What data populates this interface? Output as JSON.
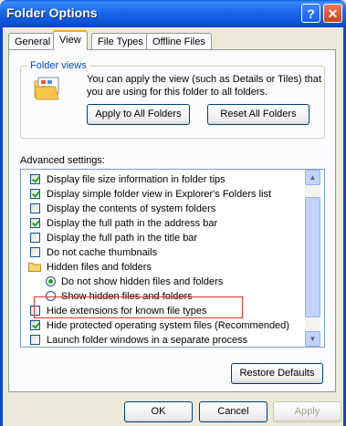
{
  "window": {
    "title": "Folder Options",
    "help_label": "?",
    "close_label": "✕"
  },
  "tabs": [
    {
      "label": "General"
    },
    {
      "label": "View"
    },
    {
      "label": "File Types"
    },
    {
      "label": "Offline Files"
    }
  ],
  "folder_views": {
    "label": "Folder views",
    "description": "You can apply the view (such as Details or Tiles) that you are using for this folder to all folders.",
    "apply_all_label": "Apply to All Folders",
    "reset_all_label": "Reset All Folders"
  },
  "advanced": {
    "label": "Advanced settings:",
    "items": [
      {
        "type": "checkbox",
        "checked": true,
        "label": "Display file size information in folder tips"
      },
      {
        "type": "checkbox",
        "checked": true,
        "label": "Display simple folder view in Explorer's Folders list"
      },
      {
        "type": "checkbox",
        "checked": false,
        "label": "Display the contents of system folders"
      },
      {
        "type": "checkbox",
        "checked": true,
        "label": "Display the full path in the address bar"
      },
      {
        "type": "checkbox",
        "checked": false,
        "label": "Display the full path in the title bar"
      },
      {
        "type": "checkbox",
        "checked": false,
        "label": "Do not cache thumbnails"
      },
      {
        "type": "folder",
        "label": "Hidden files and folders"
      },
      {
        "type": "radio",
        "checked": true,
        "label": "Do not show hidden files and folders"
      },
      {
        "type": "radio",
        "checked": false,
        "label": "Show hidden files and folders"
      },
      {
        "type": "checkbox",
        "checked": false,
        "label": "Hide extensions for known file types"
      },
      {
        "type": "checkbox",
        "checked": true,
        "label": "Hide protected operating system files (Recommended)"
      },
      {
        "type": "checkbox",
        "checked": false,
        "label": "Launch folder windows in a separate process"
      }
    ],
    "restore_defaults_label": "Restore Defaults"
  },
  "footer": {
    "ok_label": "OK",
    "cancel_label": "Cancel",
    "apply_label": "Apply"
  },
  "colors": {
    "title_bar": "#0a5fe6",
    "group_label": "#0046d5",
    "highlight": "#e03030",
    "check": "#21a121"
  }
}
